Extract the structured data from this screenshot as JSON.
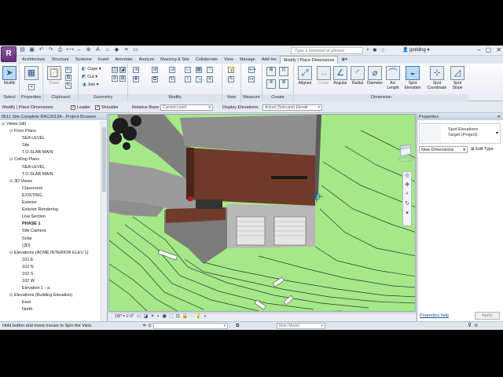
{
  "app": {
    "logo_letter": "R",
    "search_placeholder": "Type a keyword or phrase",
    "user": "jpolding",
    "qat_icons": [
      "open-icon",
      "save-icon",
      "undo-icon",
      "redo-icon",
      "print-icon",
      "measure-icon",
      "dimension-icon",
      "tag-icon",
      "text-icon",
      "3d-icon",
      "section-icon",
      "thin-lines-icon",
      "close-windows-icon"
    ]
  },
  "tabs": [
    "Architecture",
    "Structure",
    "Systems",
    "Insert",
    "Annotate",
    "Analyze",
    "Massing & Site",
    "Collaborate",
    "View",
    "Manage",
    "Add-Ins",
    "Modify | Place Dimensions"
  ],
  "ribbon": {
    "select": {
      "modify": "Modify",
      "title": "Select"
    },
    "properties": {
      "title": "Properties",
      "label": "Properties"
    },
    "clipboard": {
      "paste": "Paste",
      "title": "Clipboard"
    },
    "geometry": {
      "cope": "Cope",
      "cut": "Cut",
      "join": "Join",
      "title": "Geometry"
    },
    "modify": {
      "title": "Modify"
    },
    "view": {
      "title": "View"
    },
    "measure": {
      "title": "Measure"
    },
    "create": {
      "title": "Create"
    },
    "dimension": {
      "title": "Dimension",
      "buttons": [
        "Aligned",
        "Linear",
        "Angular",
        "Radial",
        "Diameter",
        "Arc Length",
        "Spot Elevation",
        "Spot Coordinate",
        "Spot Slope"
      ]
    }
  },
  "options": {
    "context": "Modify | Place Dimensions",
    "leader": "Leader",
    "shoulder": "Shoulder",
    "relative_base_label": "Relative Base:",
    "relative_base": "Current Level",
    "display_elev_label": "Display Elevations:",
    "display_elev": "Actual (Selected) Elevati"
  },
  "browser": {
    "title": "0511 Site Complete RAC2013A - Project Browser",
    "items": [
      {
        "indent": 0,
        "toggle": "−",
        "label": "Views (all)"
      },
      {
        "indent": 1,
        "toggle": "−",
        "label": "Floor Plans"
      },
      {
        "indent": 2,
        "toggle": "",
        "label": "SEA LEVEL"
      },
      {
        "indent": 2,
        "toggle": "",
        "label": "Site"
      },
      {
        "indent": 2,
        "toggle": "",
        "label": "T.O.SLAB MAIN"
      },
      {
        "indent": 1,
        "toggle": "−",
        "label": "Ceiling Plans"
      },
      {
        "indent": 2,
        "toggle": "",
        "label": "SEA LEVEL"
      },
      {
        "indent": 2,
        "toggle": "",
        "label": "T.O.SLAB MAIN"
      },
      {
        "indent": 1,
        "toggle": "−",
        "label": "3D Views"
      },
      {
        "indent": 2,
        "toggle": "",
        "label": "Classroom"
      },
      {
        "indent": 2,
        "toggle": "",
        "label": "EXISTING"
      },
      {
        "indent": 2,
        "toggle": "",
        "label": "Exterior"
      },
      {
        "indent": 2,
        "toggle": "",
        "label": "Exterior Rendering"
      },
      {
        "indent": 2,
        "toggle": "",
        "label": "Live Section"
      },
      {
        "indent": 2,
        "toggle": "",
        "label": "PHASE 1",
        "bold": true
      },
      {
        "indent": 2,
        "toggle": "",
        "label": "Site Camera"
      },
      {
        "indent": 2,
        "toggle": "",
        "label": "Solar"
      },
      {
        "indent": 2,
        "toggle": "",
        "label": "{3D}"
      },
      {
        "indent": 1,
        "toggle": "−",
        "label": "Elevations (ACME INTERIOR ELEV 1)"
      },
      {
        "indent": 2,
        "toggle": "",
        "label": "102 E"
      },
      {
        "indent": 2,
        "toggle": "",
        "label": "102 N"
      },
      {
        "indent": 2,
        "toggle": "",
        "label": "102 S"
      },
      {
        "indent": 2,
        "toggle": "",
        "label": "102 W"
      },
      {
        "indent": 2,
        "toggle": "",
        "label": "Elevation 1 - a"
      },
      {
        "indent": 1,
        "toggle": "−",
        "label": "Elevations (Building Elevation)"
      },
      {
        "indent": 2,
        "toggle": "",
        "label": "East"
      },
      {
        "indent": 2,
        "toggle": "",
        "label": "North"
      }
    ]
  },
  "viewbar": {
    "scale": "1/8\" = 1'-0\""
  },
  "properties": {
    "title": "Properties",
    "type_line1": "Spot Elevations",
    "type_line2": "Target (Project)",
    "instance": "New Dimensions",
    "edit_type": "Edit Type",
    "help": "Properties help",
    "apply": "Apply"
  },
  "status": {
    "message": "Hold button and move mouse to Spin the View.",
    "worksets": "0",
    "model": "Main Model",
    "filter_count": ":0"
  },
  "colors": {
    "accent": "#8fd14f",
    "terrain": "#a4e887",
    "wall_brown": "#6f3a2a",
    "roof_gray": "#8d8d8d"
  }
}
